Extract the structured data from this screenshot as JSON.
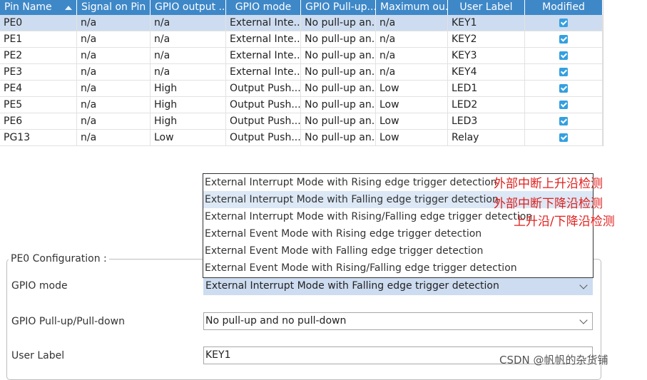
{
  "table": {
    "columns": [
      "Pin Name",
      "Signal on Pin",
      "GPIO output ...",
      "GPIO mode",
      "GPIO Pull-up...",
      "Maximum ou...",
      "User Label",
      "Modified"
    ],
    "rows": [
      {
        "pin": "PE0",
        "signal": "n/a",
        "output": "n/a",
        "mode": "External Inte...",
        "pull": "No pull-up an...",
        "max": "n/a",
        "label": "KEY1",
        "modified": true,
        "selected": true
      },
      {
        "pin": "PE1",
        "signal": "n/a",
        "output": "n/a",
        "mode": "External Inte...",
        "pull": "No pull-up an...",
        "max": "n/a",
        "label": "KEY2",
        "modified": true
      },
      {
        "pin": "PE2",
        "signal": "n/a",
        "output": "n/a",
        "mode": "External Inte...",
        "pull": "No pull-up an...",
        "max": "n/a",
        "label": "KEY3",
        "modified": true
      },
      {
        "pin": "PE3",
        "signal": "n/a",
        "output": "n/a",
        "mode": "External Inte...",
        "pull": "No pull-up an...",
        "max": "n/a",
        "label": "KEY4",
        "modified": true
      },
      {
        "pin": "PE4",
        "signal": "n/a",
        "output": "High",
        "mode": "Output Push...",
        "pull": "No pull-up an...",
        "max": "Low",
        "label": "LED1",
        "modified": true
      },
      {
        "pin": "PE5",
        "signal": "n/a",
        "output": "High",
        "mode": "Output Push...",
        "pull": "No pull-up an...",
        "max": "Low",
        "label": "LED2",
        "modified": true
      },
      {
        "pin": "PE6",
        "signal": "n/a",
        "output": "High",
        "mode": "Output Push...",
        "pull": "No pull-up an...",
        "max": "Low",
        "label": "LED3",
        "modified": true
      },
      {
        "pin": "PG13",
        "signal": "n/a",
        "output": "Low",
        "mode": "Output Push...",
        "pull": "No pull-up an...",
        "max": "Low",
        "label": "Relay",
        "modified": true
      }
    ]
  },
  "dropdown_options": [
    "External Interrupt Mode with Rising edge trigger detection",
    "External Interrupt Mode with Falling edge trigger detection",
    "External Interrupt Mode with Rising/Falling edge trigger detection",
    "External Event Mode with Rising edge trigger detection",
    "External Event Mode with Falling edge trigger detection",
    "External Event Mode with Rising/Falling edge trigger detection"
  ],
  "annotations": [
    "外部中断上升沿检测",
    "外部中断下降沿检测",
    "上升沿/下降沿检测"
  ],
  "config": {
    "title": "PE0 Configuration :",
    "gpio_mode_label": "GPIO mode",
    "gpio_mode_value": "External Interrupt Mode with Falling edge trigger detection",
    "pull_label": "GPIO Pull-up/Pull-down",
    "pull_value": "No pull-up and no pull-down",
    "user_label_label": "User Label",
    "user_label_value": "KEY1"
  },
  "watermark": "CSDN @帆帆的杂货铺",
  "colors": {
    "header": "#3e88c8",
    "selected_row": "#cddcf0",
    "checkbox": "#34a0e0",
    "annotation": "#e0201e"
  }
}
